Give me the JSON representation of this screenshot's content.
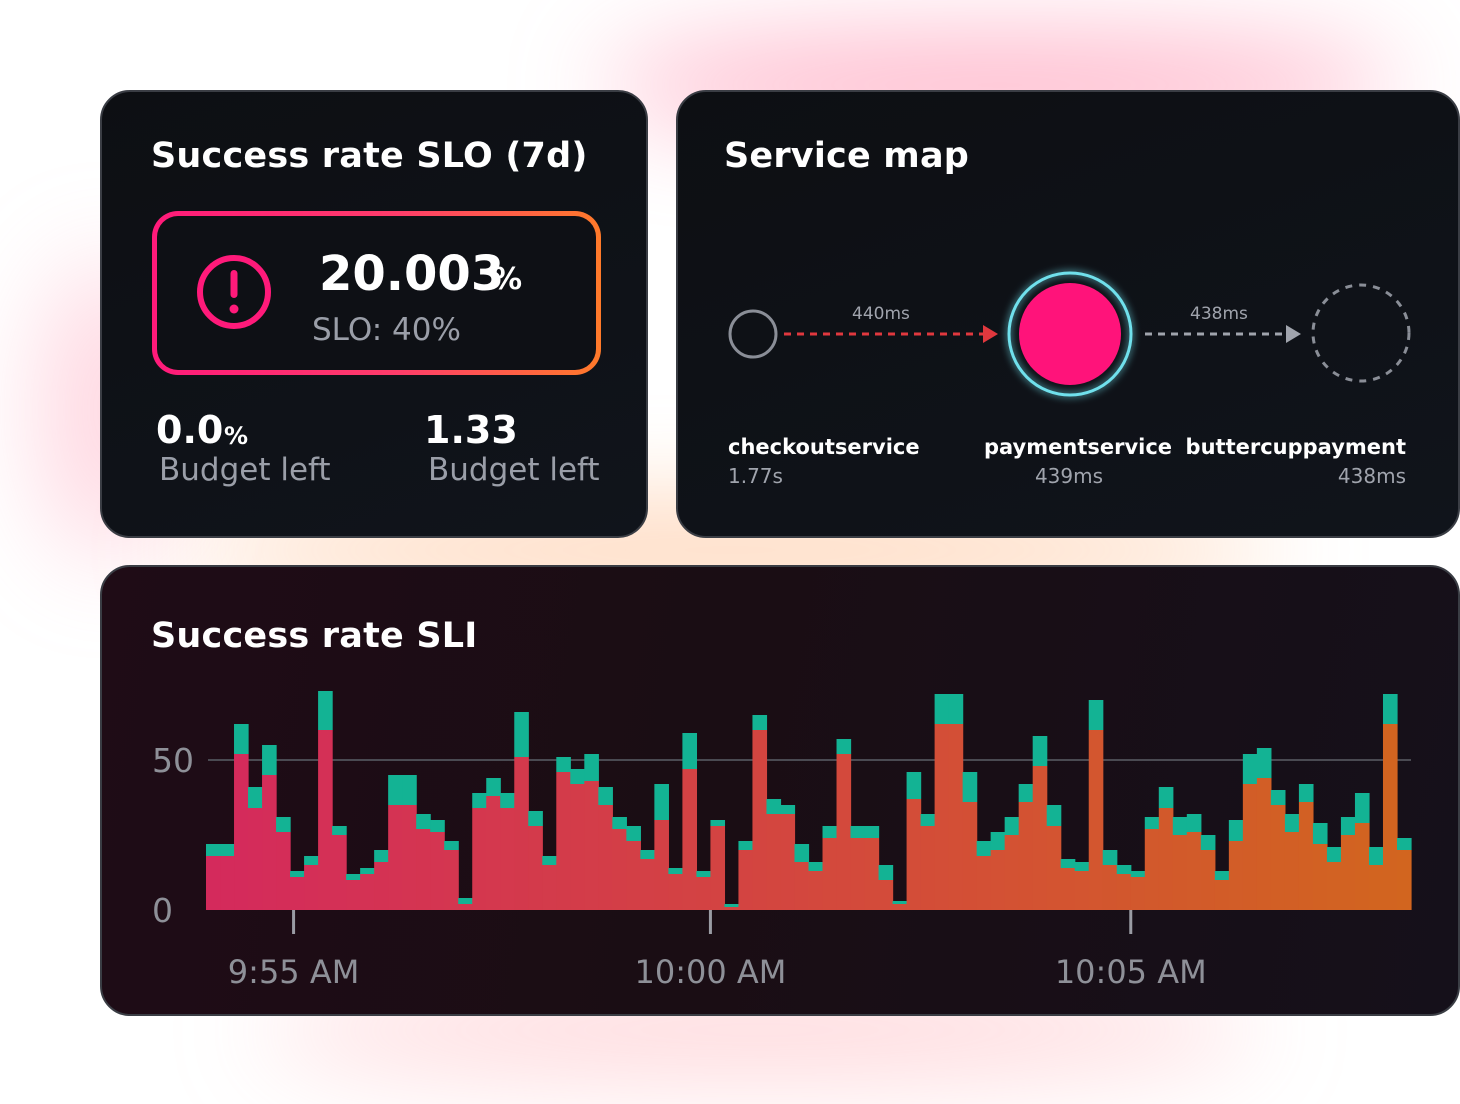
{
  "colors": {
    "card_bg": "#0d0f13",
    "accent_pink": "#ff1a7a",
    "accent_orange": "#ff7a2a",
    "teal": "#13b394",
    "muted_text": "#9a9ea8"
  },
  "slo_card": {
    "title": "Success rate SLO (7d)",
    "icon": "alert-circle-icon",
    "value": "20.003",
    "value_unit": "%",
    "target": "SLO: 40%",
    "budgets": [
      {
        "value": "0.0",
        "unit": "%",
        "label": "Budget left"
      },
      {
        "value": "1.33",
        "unit": "",
        "label": "Budget left"
      }
    ]
  },
  "service_map": {
    "title": "Service map",
    "nodes": [
      {
        "name": "checkoutservice",
        "latency": "1.77s"
      },
      {
        "name": "paymentservice",
        "latency": "439ms"
      },
      {
        "name": "buttercuppayment",
        "latency": "438ms"
      }
    ],
    "edges": [
      {
        "label": "440ms",
        "from": "checkoutservice",
        "to": "paymentservice",
        "color": "#e0383e"
      },
      {
        "label": "438ms",
        "from": "paymentservice",
        "to": "buttercuppayment",
        "color": "#a0a4ad"
      }
    ]
  },
  "sli_card": {
    "title": "Success rate SLI",
    "chart_data": {
      "type": "bar",
      "stacked": true,
      "ylim": [
        0,
        80
      ],
      "yticks": [
        0,
        50
      ],
      "grid_at": [
        50
      ],
      "x_tick_labels": [
        "9:55 AM",
        "10:00 AM",
        "10:05 AM"
      ],
      "x_tick_positions": [
        5.75,
        35.5,
        65.5
      ],
      "series": [
        {
          "color_start": "#d42a5c",
          "color_end": "#d2651f",
          "values": [
            18,
            18,
            52,
            34,
            45,
            26,
            11,
            15,
            60,
            25,
            10,
            12,
            16,
            35,
            35,
            27,
            26,
            20,
            2,
            34,
            38,
            34,
            51,
            28,
            15,
            46,
            42,
            43,
            35,
            27,
            23,
            17,
            30,
            12,
            47,
            11,
            28,
            1,
            20,
            60,
            32,
            32,
            16,
            13,
            24,
            52,
            24,
            24,
            10,
            2,
            37,
            28,
            62,
            62,
            36,
            18,
            20,
            25,
            36,
            48,
            28,
            14,
            13,
            60,
            15,
            12,
            11,
            27,
            34,
            25,
            26,
            20,
            10,
            23,
            42,
            44,
            35,
            26,
            36,
            22,
            16,
            25,
            29,
            15,
            62,
            20
          ]
        },
        {
          "color": "#13b394",
          "values": [
            4,
            4,
            10,
            7,
            10,
            5,
            2,
            3,
            13,
            3,
            2,
            2,
            4,
            10,
            10,
            5,
            4,
            3,
            2,
            5,
            6,
            5,
            15,
            5,
            3,
            5,
            5,
            9,
            6,
            4,
            5,
            3,
            12,
            2,
            12,
            2,
            2,
            1,
            3,
            5,
            5,
            3,
            6,
            3,
            4,
            5,
            4,
            4,
            5,
            1,
            9,
            4,
            10,
            10,
            10,
            5,
            6,
            6,
            6,
            10,
            7,
            3,
            3,
            10,
            5,
            3,
            2,
            4,
            7,
            6,
            6,
            5,
            3,
            7,
            10,
            10,
            5,
            6,
            6,
            7,
            5,
            6,
            10,
            6,
            10,
            4
          ]
        }
      ]
    }
  }
}
